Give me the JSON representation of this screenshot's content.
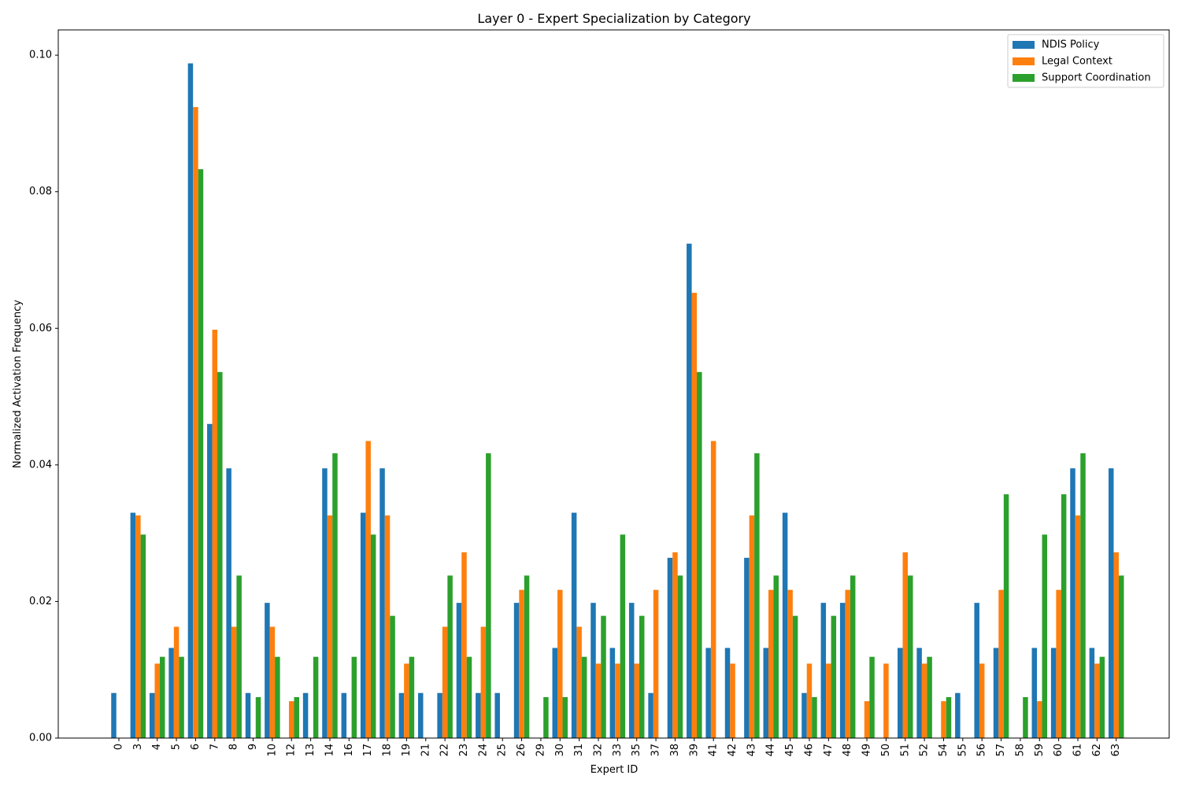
{
  "chart_data": {
    "type": "bar",
    "title": "Layer 0 - Expert Specialization by Category",
    "xlabel": "Expert ID",
    "ylabel": "Normalized Activation Frequency",
    "ylim": [
      0,
      0.1037
    ],
    "yticks": [
      0.0,
      0.02,
      0.04,
      0.06,
      0.08,
      0.1
    ],
    "ytick_labels": [
      "0.00",
      "0.02",
      "0.04",
      "0.06",
      "0.08",
      "0.10"
    ],
    "grid": false,
    "legend_position": "top-right",
    "categories": [
      "0",
      "3",
      "4",
      "5",
      "6",
      "7",
      "8",
      "9",
      "10",
      "12",
      "13",
      "14",
      "16",
      "17",
      "18",
      "19",
      "21",
      "22",
      "23",
      "24",
      "25",
      "26",
      "29",
      "30",
      "31",
      "32",
      "33",
      "35",
      "37",
      "38",
      "39",
      "41",
      "42",
      "43",
      "44",
      "45",
      "46",
      "47",
      "48",
      "49",
      "50",
      "51",
      "52",
      "54",
      "55",
      "56",
      "57",
      "58",
      "59",
      "60",
      "61",
      "62",
      "63"
    ],
    "series": [
      {
        "name": "NDIS Policy",
        "color": "#1f77b4",
        "values": [
          0.0066,
          0.033,
          0.0066,
          0.0132,
          0.0988,
          0.046,
          0.0395,
          0.0066,
          0.0198,
          0,
          0.0066,
          0.0395,
          0.0066,
          0.033,
          0.0395,
          0.0066,
          0.0066,
          0.0066,
          0.0198,
          0.0066,
          0.0066,
          0.0198,
          0,
          0.0132,
          0.033,
          0.0198,
          0.0132,
          0.0198,
          0.0066,
          0.0264,
          0.0724,
          0.0132,
          0.0132,
          0.0264,
          0.0132,
          0.033,
          0.0066,
          0.0198,
          0.0198,
          0,
          0,
          0.0132,
          0.0132,
          0,
          0.0066,
          0.0198,
          0.0132,
          0,
          0.0132,
          0.0132,
          0.0395,
          0.0132,
          0.0395
        ]
      },
      {
        "name": "Legal Context",
        "color": "#ff7f0e",
        "values": [
          0,
          0.0326,
          0.0109,
          0.0163,
          0.0924,
          0.0598,
          0.0163,
          0,
          0.0163,
          0.0054,
          0,
          0.0326,
          0,
          0.0435,
          0.0326,
          0.0109,
          0,
          0.0163,
          0.0272,
          0.0163,
          0,
          0.0217,
          0,
          0.0217,
          0.0163,
          0.0109,
          0.0109,
          0.0109,
          0.0217,
          0.0272,
          0.0652,
          0.0435,
          0.0109,
          0.0326,
          0.0217,
          0.0217,
          0.0109,
          0.0109,
          0.0217,
          0.0054,
          0.0109,
          0.0272,
          0.0109,
          0.0054,
          0,
          0.0109,
          0.0217,
          0,
          0.0054,
          0.0217,
          0.0326,
          0.0109,
          0.0272
        ]
      },
      {
        "name": "Support Coordination",
        "color": "#2ca02c",
        "values": [
          0,
          0.0298,
          0.0119,
          0.0119,
          0.0833,
          0.0536,
          0.0238,
          0.006,
          0.0119,
          0.006,
          0.0119,
          0.0417,
          0.0119,
          0.0298,
          0.0179,
          0.0119,
          0,
          0.0238,
          0.0119,
          0.0417,
          0,
          0.0238,
          0.006,
          0.006,
          0.0119,
          0.0179,
          0.0298,
          0.0179,
          0,
          0.0238,
          0.0536,
          0,
          0,
          0.0417,
          0.0238,
          0.0179,
          0.006,
          0.0179,
          0.0238,
          0.0119,
          0,
          0.0238,
          0.0119,
          0.006,
          0,
          0,
          0.0357,
          0.006,
          0.0298,
          0.0357,
          0.0417,
          0.0119,
          0.0238
        ]
      }
    ]
  }
}
